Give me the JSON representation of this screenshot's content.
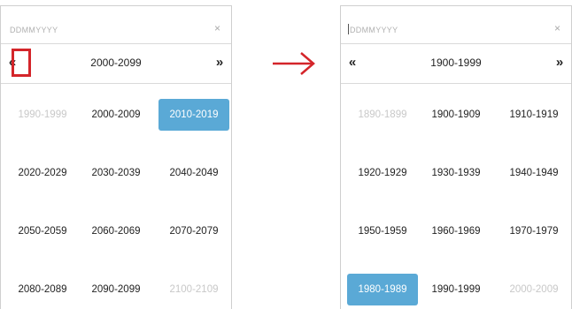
{
  "left_picker": {
    "placeholder": "DDMMYYYY",
    "clear_icon": "×",
    "prev_icon": "«",
    "next_icon": "»",
    "title": "2000-2099",
    "cells": [
      {
        "label": "1990-1999",
        "state": "muted"
      },
      {
        "label": "2000-2009",
        "state": "normal"
      },
      {
        "label": "2010-2019",
        "state": "active"
      },
      {
        "label": "2020-2029",
        "state": "normal"
      },
      {
        "label": "2030-2039",
        "state": "normal"
      },
      {
        "label": "2040-2049",
        "state": "normal"
      },
      {
        "label": "2050-2059",
        "state": "normal"
      },
      {
        "label": "2060-2069",
        "state": "normal"
      },
      {
        "label": "2070-2079",
        "state": "normal"
      },
      {
        "label": "2080-2089",
        "state": "normal"
      },
      {
        "label": "2090-2099",
        "state": "normal"
      },
      {
        "label": "2100-2109",
        "state": "muted"
      }
    ]
  },
  "right_picker": {
    "placeholder": "DDMMYYYY",
    "clear_icon": "×",
    "prev_icon": "«",
    "next_icon": "»",
    "title": "1900-1999",
    "cells": [
      {
        "label": "1890-1899",
        "state": "muted"
      },
      {
        "label": "1900-1909",
        "state": "normal"
      },
      {
        "label": "1910-1919",
        "state": "normal"
      },
      {
        "label": "1920-1929",
        "state": "normal"
      },
      {
        "label": "1930-1939",
        "state": "normal"
      },
      {
        "label": "1940-1949",
        "state": "normal"
      },
      {
        "label": "1950-1959",
        "state": "normal"
      },
      {
        "label": "1960-1969",
        "state": "normal"
      },
      {
        "label": "1970-1979",
        "state": "normal"
      },
      {
        "label": "1980-1989",
        "state": "active"
      },
      {
        "label": "1990-1999",
        "state": "normal"
      },
      {
        "label": "2000-2009",
        "state": "muted"
      }
    ]
  },
  "colors": {
    "active": "#5aa9d6",
    "highlight": "#d4252a",
    "arrow": "#d4252a",
    "muted_text": "#c8c8c8"
  },
  "icons": {
    "transition_arrow": "right-arrow-icon"
  }
}
